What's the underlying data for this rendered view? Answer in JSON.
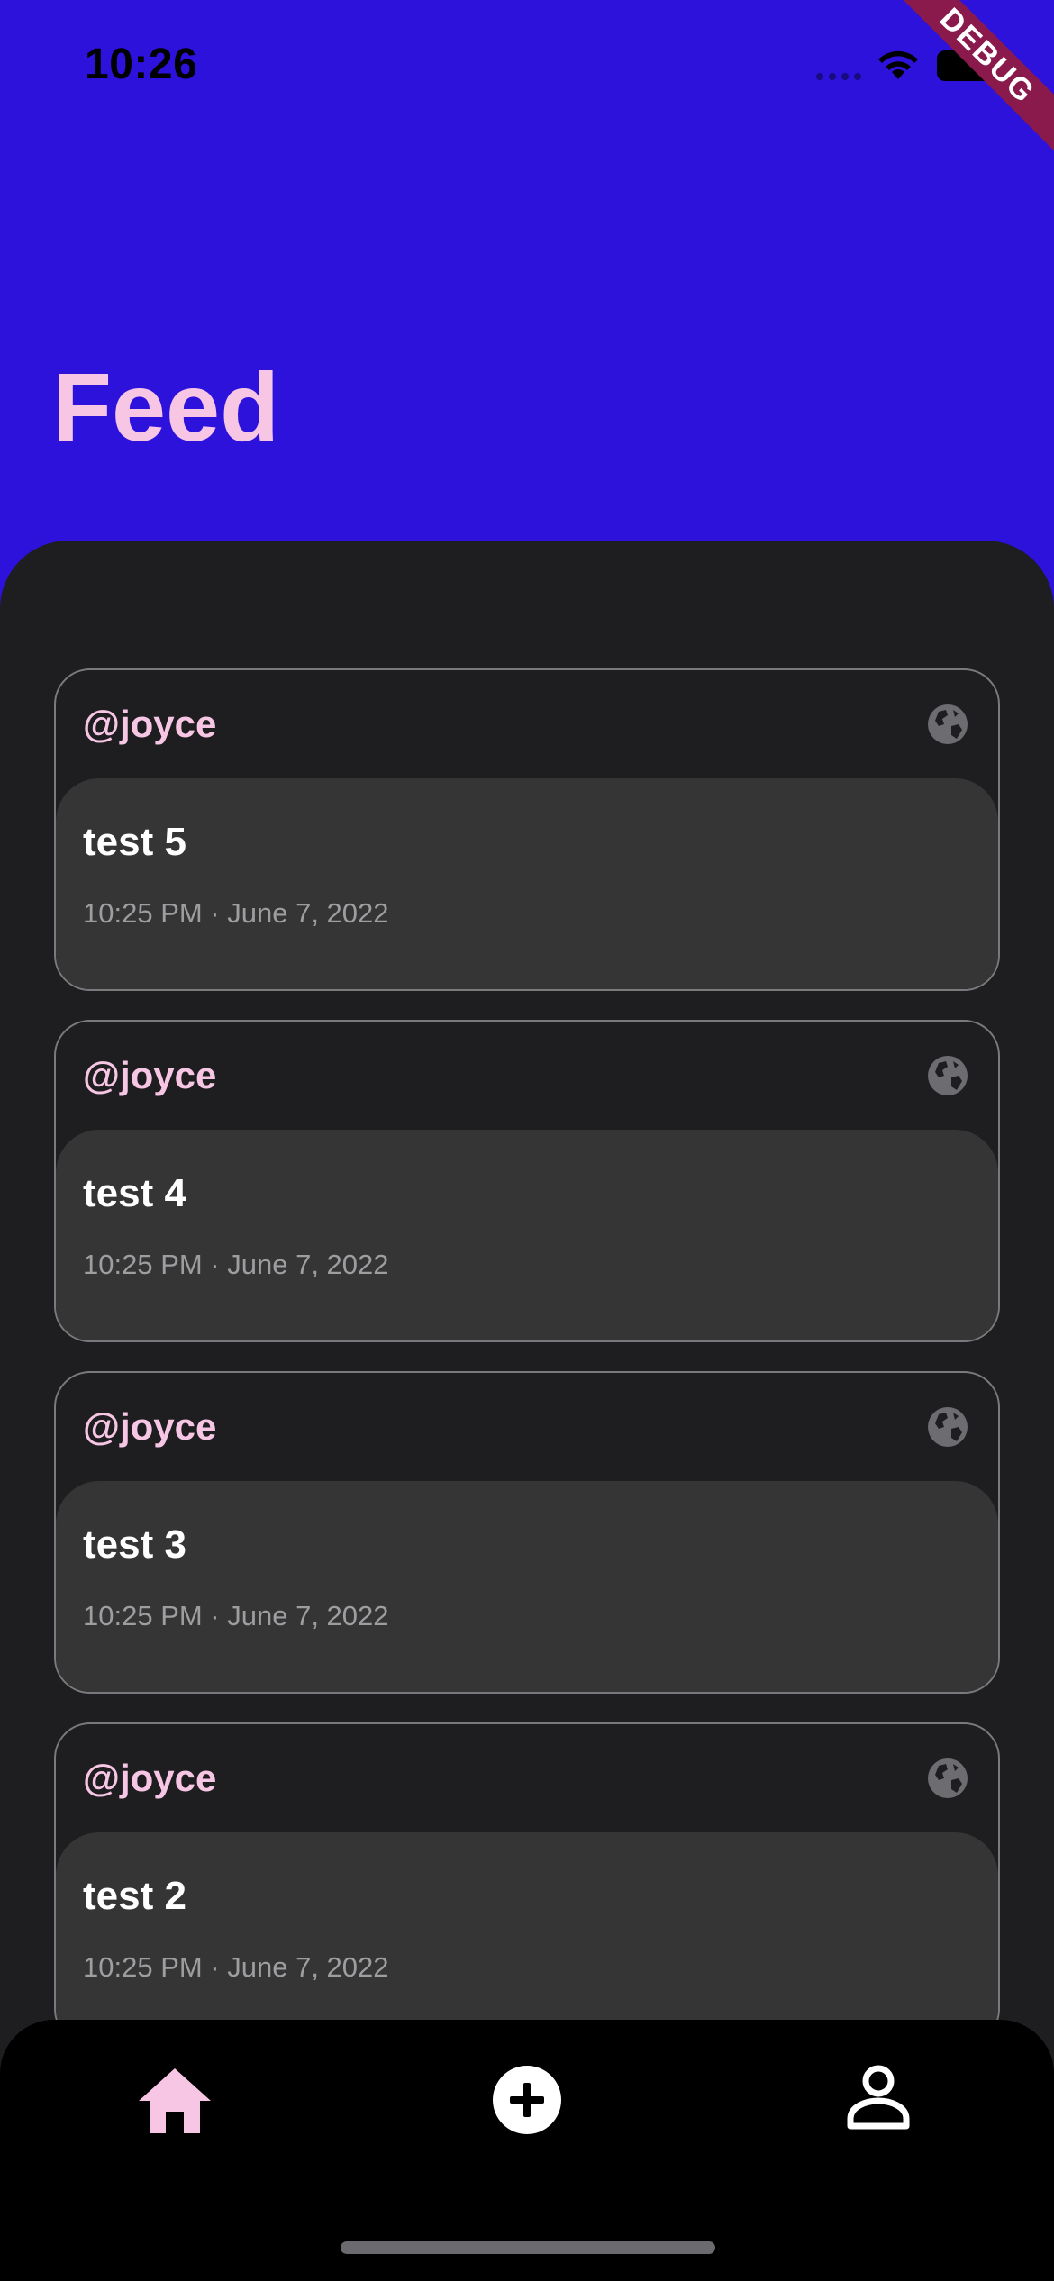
{
  "status_bar": {
    "time": "10:26"
  },
  "debug_banner": "DEBUG",
  "header": {
    "title": "Feed"
  },
  "posts": [
    {
      "username": "@joyce",
      "text": "test 5",
      "meta": "10:25 PM · June 7, 2022",
      "visibility_icon": "globe-icon"
    },
    {
      "username": "@joyce",
      "text": "test 4",
      "meta": "10:25 PM · June 7, 2022",
      "visibility_icon": "globe-icon"
    },
    {
      "username": "@joyce",
      "text": "test 3",
      "meta": "10:25 PM · June 7, 2022",
      "visibility_icon": "globe-icon"
    },
    {
      "username": "@joyce",
      "text": "test 2",
      "meta": "10:25 PM · June 7, 2022",
      "visibility_icon": "globe-icon"
    }
  ],
  "bottom_nav": {
    "items": [
      {
        "icon": "home-icon",
        "active": true
      },
      {
        "icon": "add-circle-icon",
        "active": false
      },
      {
        "icon": "person-icon",
        "active": false
      }
    ]
  },
  "colors": {
    "header_background": "#2d12dc",
    "accent_pink": "#f6c6e4",
    "panel_background": "#1e1d1f",
    "card_body": "#353536",
    "nav_background": "#000000",
    "debug_ribbon": "#8a1a4c"
  }
}
